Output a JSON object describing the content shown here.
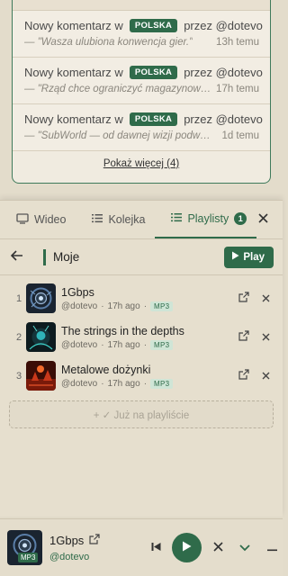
{
  "notifications": {
    "items": [
      {
        "prefix": "Nowy komentarz w",
        "tag": "POLSKA",
        "by": "przez @dotevo",
        "quote": "— \"Wasza ulubiona konwencja gier.\"",
        "time": "13h temu"
      },
      {
        "prefix": "Nowy komentarz w",
        "tag": "POLSKA",
        "by": "przez @dotevo",
        "quote": "— \"Rząd chce ograniczyć magazynowani...",
        "time": "17h temu"
      },
      {
        "prefix": "Nowy komentarz w",
        "tag": "POLSKA",
        "by": "przez @dotevo",
        "quote": "— \"SubWorld — od dawnej wizji podwodne...",
        "time": "1d temu"
      }
    ],
    "show_more": "Pokaż więcej (4)"
  },
  "tabs": {
    "video": "Wideo",
    "queue": "Kolejka",
    "playlists": "Playlisty",
    "playlists_count": "1"
  },
  "playlist": {
    "name": "Moje",
    "play_label": "Play",
    "tracks": [
      {
        "num": "1",
        "title": "1Gbps",
        "author": "@dotevo",
        "age": "17h ago",
        "format": "MP3"
      },
      {
        "num": "2",
        "title": "The strings in the depths",
        "author": "@dotevo",
        "age": "17h ago",
        "format": "MP3"
      },
      {
        "num": "3",
        "title": "Metalowe dożynki",
        "author": "@dotevo",
        "age": "17h ago",
        "format": "MP3"
      }
    ],
    "already_label": "+ ✓ Już na playliście"
  },
  "player": {
    "title": "1Gbps",
    "artist": "@dotevo",
    "format": "MP3"
  },
  "colors": {
    "accent": "#2f6b4a",
    "background": "#e3dccb"
  }
}
